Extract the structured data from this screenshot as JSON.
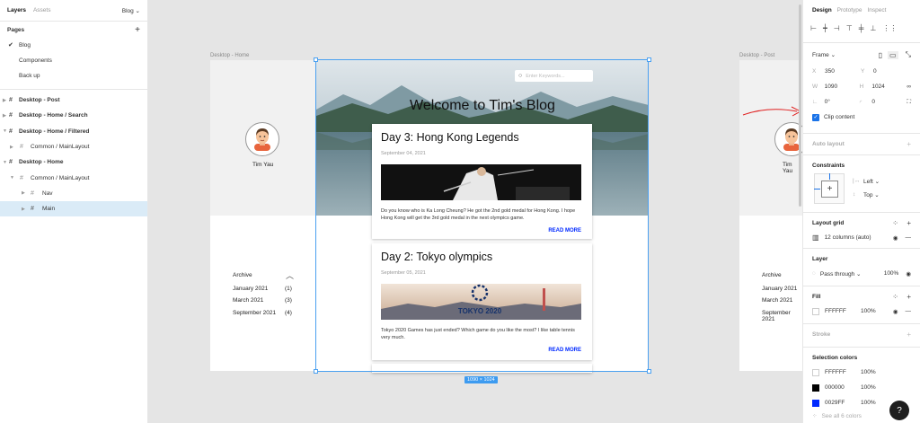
{
  "left_panel": {
    "tabs": [
      "Layers",
      "Assets"
    ],
    "page_selector": "Blog ⌄",
    "pages_title": "Pages",
    "pages": [
      {
        "label": "Blog",
        "checked": true
      },
      {
        "label": "Components",
        "checked": false
      },
      {
        "label": "Back up",
        "checked": false
      }
    ],
    "layers": [
      {
        "label": "Desktop - Post",
        "bold": true
      },
      {
        "label": "Desktop - Home / Search",
        "bold": true
      },
      {
        "label": "Desktop - Home / Filtered",
        "bold": true
      },
      {
        "label": "Common / MainLayout",
        "bold": false
      },
      {
        "label": "Desktop - Home",
        "bold": true
      },
      {
        "label": "Common / MainLayout",
        "bold": false
      },
      {
        "label": "Nav",
        "bold": false
      },
      {
        "label": "Main",
        "bold": false,
        "selected": true
      }
    ]
  },
  "canvas": {
    "frame_labels": [
      "Desktop - Home",
      "Desktop - Post"
    ],
    "profile_name": "Tim Yau",
    "archive": {
      "title": "Archive",
      "items": [
        {
          "month": "January 2021",
          "count": "(1)"
        },
        {
          "month": "March 2021",
          "count": "(3)"
        },
        {
          "month": "September 2021",
          "count": "(4)"
        }
      ]
    },
    "search_placeholder": "Enter Keywords...",
    "hero_title": "Welcome to Tim's Blog",
    "posts": [
      {
        "title": "Day 3: Hong Kong Legends",
        "date": "September 04, 2021",
        "body": "Do you know who is Ka Long Cheung? He got the 2nd gold medal for Hong Kong. I hope Hong Kong will get the 3rd gold medal in the next olympics game.",
        "more": "READ MORE"
      },
      {
        "title": "Day 2: Tokyo olympics",
        "date": "September 05, 2021",
        "body": "Tokyo 2020 Games has just ended? Which game do you like the most? I like table tennis very much.",
        "more": "READ MORE",
        "image_text": "TOKYO 2020"
      }
    ],
    "size_badge": "1090 × 1024"
  },
  "right_panel": {
    "tabs": [
      "Design",
      "Prototype",
      "Inspect"
    ],
    "frame": {
      "title": "Frame ⌄",
      "x": "350",
      "y": "0",
      "w": "1090",
      "h": "1024",
      "rotation": "0°",
      "radius": "0",
      "clip_content": "Clip content"
    },
    "auto_layout": "Auto layout",
    "constraints": {
      "title": "Constraints",
      "horizontal": "Left ⌄",
      "vertical": "Top ⌄"
    },
    "layout_grid": {
      "title": "Layout grid",
      "value": "12 columns (auto)"
    },
    "layer": {
      "title": "Layer",
      "blend": "Pass through ⌄",
      "opacity": "100%"
    },
    "fill": {
      "title": "Fill",
      "hex": "FFFFFF",
      "opacity": "100%"
    },
    "stroke": "Stroke",
    "selection_colors": {
      "title": "Selection colors",
      "items": [
        {
          "hex": "FFFFFF",
          "opacity": "100%",
          "color": "#FFFFFF"
        },
        {
          "hex": "000000",
          "opacity": "100%",
          "color": "#000000"
        },
        {
          "hex": "0029FF",
          "opacity": "100%",
          "color": "#0029FF"
        }
      ],
      "see_all": "See all 6 colors"
    },
    "help": "?"
  },
  "colors": {
    "accent": "#0029FF",
    "selection": "#4aa0f0",
    "annotation": "#e02020"
  }
}
